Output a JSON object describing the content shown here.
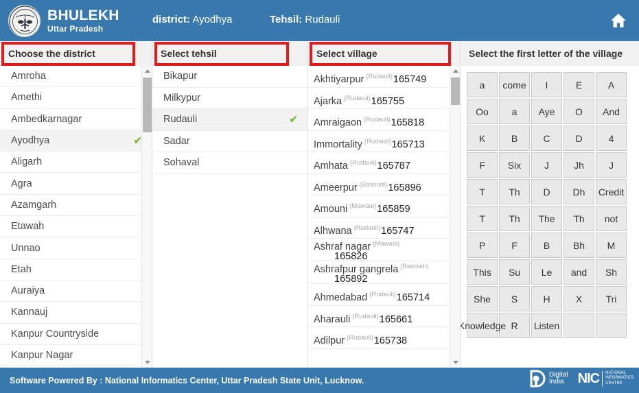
{
  "header": {
    "brand_main": "BHULEKH",
    "brand_sub": "Uttar Pradesh",
    "emblem_icon": "up-state-emblem-icon",
    "district_key": "district:",
    "district_value": "Ayodhya",
    "tehsil_key": "Tehsil:",
    "tehsil_value": "Rudauli",
    "home_icon": "home-icon",
    "bg_color": "#3878ad"
  },
  "column_headers": {
    "district": "Choose the district",
    "tehsil": "Select tehsil",
    "village": "Select village",
    "letter": "Select the first letter of the village"
  },
  "annotation": {
    "color": "#e51b1b",
    "boxes": [
      "Choose the district",
      "Select tehsil",
      "Select village"
    ]
  },
  "district_panel": {
    "selected": "Ayodhya",
    "check_color": "#7dbb42",
    "items": [
      {
        "label": "Amroha",
        "selected": false
      },
      {
        "label": "Amethi",
        "selected": false
      },
      {
        "label": "Ambedkarnagar",
        "selected": false
      },
      {
        "label": "Ayodhya",
        "selected": true
      },
      {
        "label": "Aligarh",
        "selected": false
      },
      {
        "label": "Agra",
        "selected": false
      },
      {
        "label": "Azamgarh",
        "selected": false
      },
      {
        "label": "Etawah",
        "selected": false
      },
      {
        "label": "Unnao",
        "selected": false
      },
      {
        "label": "Etah",
        "selected": false
      },
      {
        "label": "Auraiya",
        "selected": false
      },
      {
        "label": "Kannauj",
        "selected": false
      },
      {
        "label": "Kanpur Countryside",
        "selected": false
      },
      {
        "label": "Kanpur Nagar",
        "selected": false
      }
    ]
  },
  "tehsil_panel": {
    "selected": "Rudauli",
    "items": [
      {
        "label": "Bikapur",
        "selected": false
      },
      {
        "label": "Milkypur",
        "selected": false
      },
      {
        "label": "Rudauli",
        "selected": true
      },
      {
        "label": "Sadar",
        "selected": false
      },
      {
        "label": "Sohaval",
        "selected": false
      }
    ]
  },
  "village_panel": {
    "items": [
      {
        "name": "Akhtiyarpur",
        "tehsil": "(Rudauli)",
        "code": "165749",
        "wrap": false,
        "clipped": false
      },
      {
        "name": "Ajarka",
        "tehsil": "(Rudauli)",
        "code": "165755",
        "wrap": false,
        "clipped": false
      },
      {
        "name": "Amraigaon",
        "tehsil": "(Rudauli)",
        "code": "165818",
        "wrap": false,
        "clipped": false
      },
      {
        "name": "Immortality",
        "tehsil": "(Rudauli)",
        "code": "165713",
        "wrap": false,
        "clipped": false
      },
      {
        "name": "Amhata",
        "tehsil": "(Rudauli)",
        "code": "165787",
        "wrap": false,
        "clipped": false
      },
      {
        "name": "Ameerpur",
        "tehsil": "(Basoudi)",
        "code": "165896",
        "wrap": false,
        "clipped": false
      },
      {
        "name": "Amouni",
        "tehsil": "(Mawaai)",
        "code": "165859",
        "wrap": false,
        "clipped": false
      },
      {
        "name": "Alhwana",
        "tehsil": "(Rudauli)",
        "code": "165747",
        "wrap": false,
        "clipped": false
      },
      {
        "name": "Ashraf nagar",
        "tehsil": "(Mawaai)",
        "code": "165826",
        "wrap": true,
        "clipped": false
      },
      {
        "name": "Ashrafpur gangrela",
        "tehsil": "(Basoudi)",
        "code": "165892",
        "wrap": true,
        "clipped": false
      },
      {
        "name": "Ahmedabad",
        "tehsil": "(Rudauli)",
        "code": "165714",
        "wrap": false,
        "clipped": false
      },
      {
        "name": "Aharauli",
        "tehsil": "(Rudauli)",
        "code": "165661",
        "wrap": false,
        "clipped": false
      },
      {
        "name": "Adilpur",
        "tehsil": "(Rudauli)",
        "code": "165738",
        "wrap": false,
        "clipped": false
      },
      {
        "name": "",
        "tehsil": "",
        "code": "",
        "wrap": false,
        "clipped": true
      }
    ]
  },
  "letter_panel": {
    "cells": [
      "a",
      "come",
      "I",
      "E",
      "A",
      "Oo",
      "a",
      "Aye",
      "O",
      "And",
      "K",
      "B",
      "C",
      "D",
      "4",
      "F",
      "Six",
      "J",
      "Jh",
      "J",
      "T",
      "Th",
      "D",
      "Dh",
      "Credit",
      "T",
      "Th",
      "The",
      "Th",
      "not",
      "P",
      "F",
      "B",
      "Bh",
      "M",
      "This",
      "Su",
      "Le",
      "and",
      "Sh",
      "She",
      "S",
      "H",
      "X",
      "Tri",
      "Knowledge",
      "R",
      "Listen",
      "",
      ""
    ]
  },
  "scrollbars": {
    "district": {
      "up_icon": "scroll-up-arrow-icon",
      "down_icon": "scroll-down-arrow-icon"
    },
    "village": {
      "up_icon": "scroll-up-arrow-icon",
      "down_icon": "scroll-down-arrow-icon"
    }
  },
  "footer": {
    "text": "Software Powered By : National Informatics Center, Uttar Pradesh State Unit, Lucknow.",
    "digital_india_line1": "Digital",
    "digital_india_line2": "India",
    "nic_mark": "NIC",
    "nic_line1": "NATIONAL",
    "nic_line2": "INFORMATICS",
    "nic_line3": "CENTRE",
    "bg_color": "#3878ad"
  }
}
